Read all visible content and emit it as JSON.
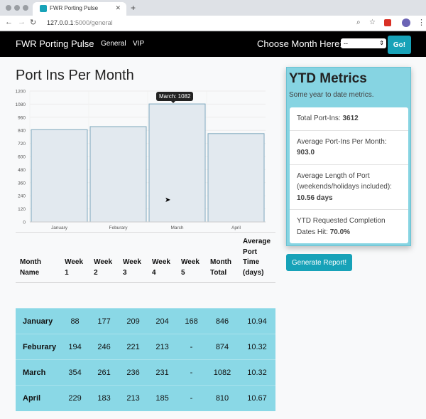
{
  "browser": {
    "tab_title": "FWR Porting Pulse",
    "url_host": "127.0.0.1",
    "url_path": ":5000/general"
  },
  "navbar": {
    "brand": "FWR Porting Pulse",
    "links": [
      "General",
      "VIP"
    ],
    "month_label": "Choose Month Here:",
    "month_selected": "--",
    "go_label": "Go!"
  },
  "chart": {
    "title": "Port Ins Per Month",
    "tooltip": "March: 1082"
  },
  "chart_data": {
    "type": "bar",
    "categories": [
      "January",
      "Feburary",
      "March",
      "April"
    ],
    "values": [
      846,
      874,
      1082,
      810
    ],
    "ylim": [
      0,
      1200
    ],
    "yticks": [
      0,
      120,
      240,
      360,
      480,
      600,
      720,
      840,
      960,
      1080,
      1200
    ],
    "grid": true,
    "colors": {
      "fill": "#e2e9ef",
      "stroke": "#7ea8bd"
    }
  },
  "table": {
    "headers": [
      "Month Name",
      "Week 1",
      "Week 2",
      "Week 3",
      "Week 4",
      "Week 5",
      "Month Total",
      "Average Port Time (days)"
    ],
    "rows": [
      [
        "January",
        "88",
        "177",
        "209",
        "204",
        "168",
        "846",
        "10.94"
      ],
      [
        "Feburary",
        "194",
        "246",
        "221",
        "213",
        "-",
        "874",
        "10.32"
      ],
      [
        "March",
        "354",
        "261",
        "236",
        "231",
        "-",
        "1082",
        "10.32"
      ],
      [
        "April",
        "229",
        "183",
        "213",
        "185",
        "-",
        "810",
        "10.67"
      ]
    ]
  },
  "ytd": {
    "title": "YTD Metrics",
    "subtitle": "Some year to date metrics.",
    "items": [
      {
        "label": "Total Port-Ins: ",
        "value": "3612"
      },
      {
        "label": "Average Port-Ins Per Month: ",
        "value": "903.0"
      },
      {
        "label": "Average Length of Port (weekends/holidays included): ",
        "value": "10.56 days"
      },
      {
        "label": "YTD Requested Completion Dates Hit: ",
        "value": "70.0%"
      }
    ]
  },
  "report_button": "Generate Report!"
}
